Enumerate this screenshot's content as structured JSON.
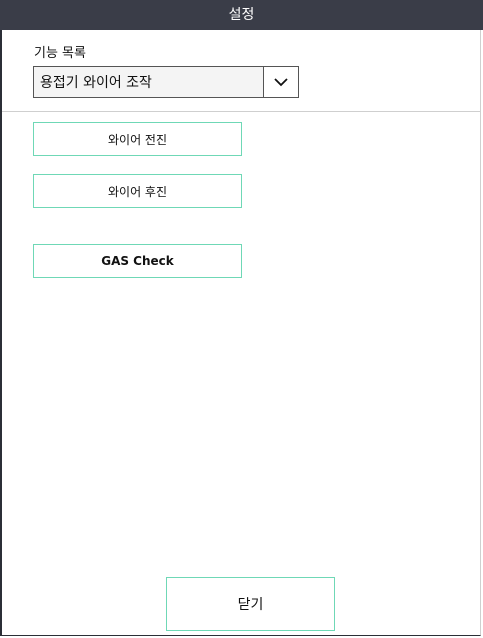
{
  "window": {
    "title": "설정"
  },
  "function_list": {
    "label": "기능 목록",
    "selected": "용접기 와이어 조작",
    "toggle_icon": "chevron-down-icon"
  },
  "actions": {
    "wire_forward": "와이어 전진",
    "wire_backward": "와이어 후진",
    "gas_check": "GAS Check"
  },
  "footer": {
    "close_label": "닫기"
  },
  "colors": {
    "title_bar": "#3a3d48",
    "button_border": "#6fd8b6",
    "dropdown_bg": "#f4f4f4"
  }
}
